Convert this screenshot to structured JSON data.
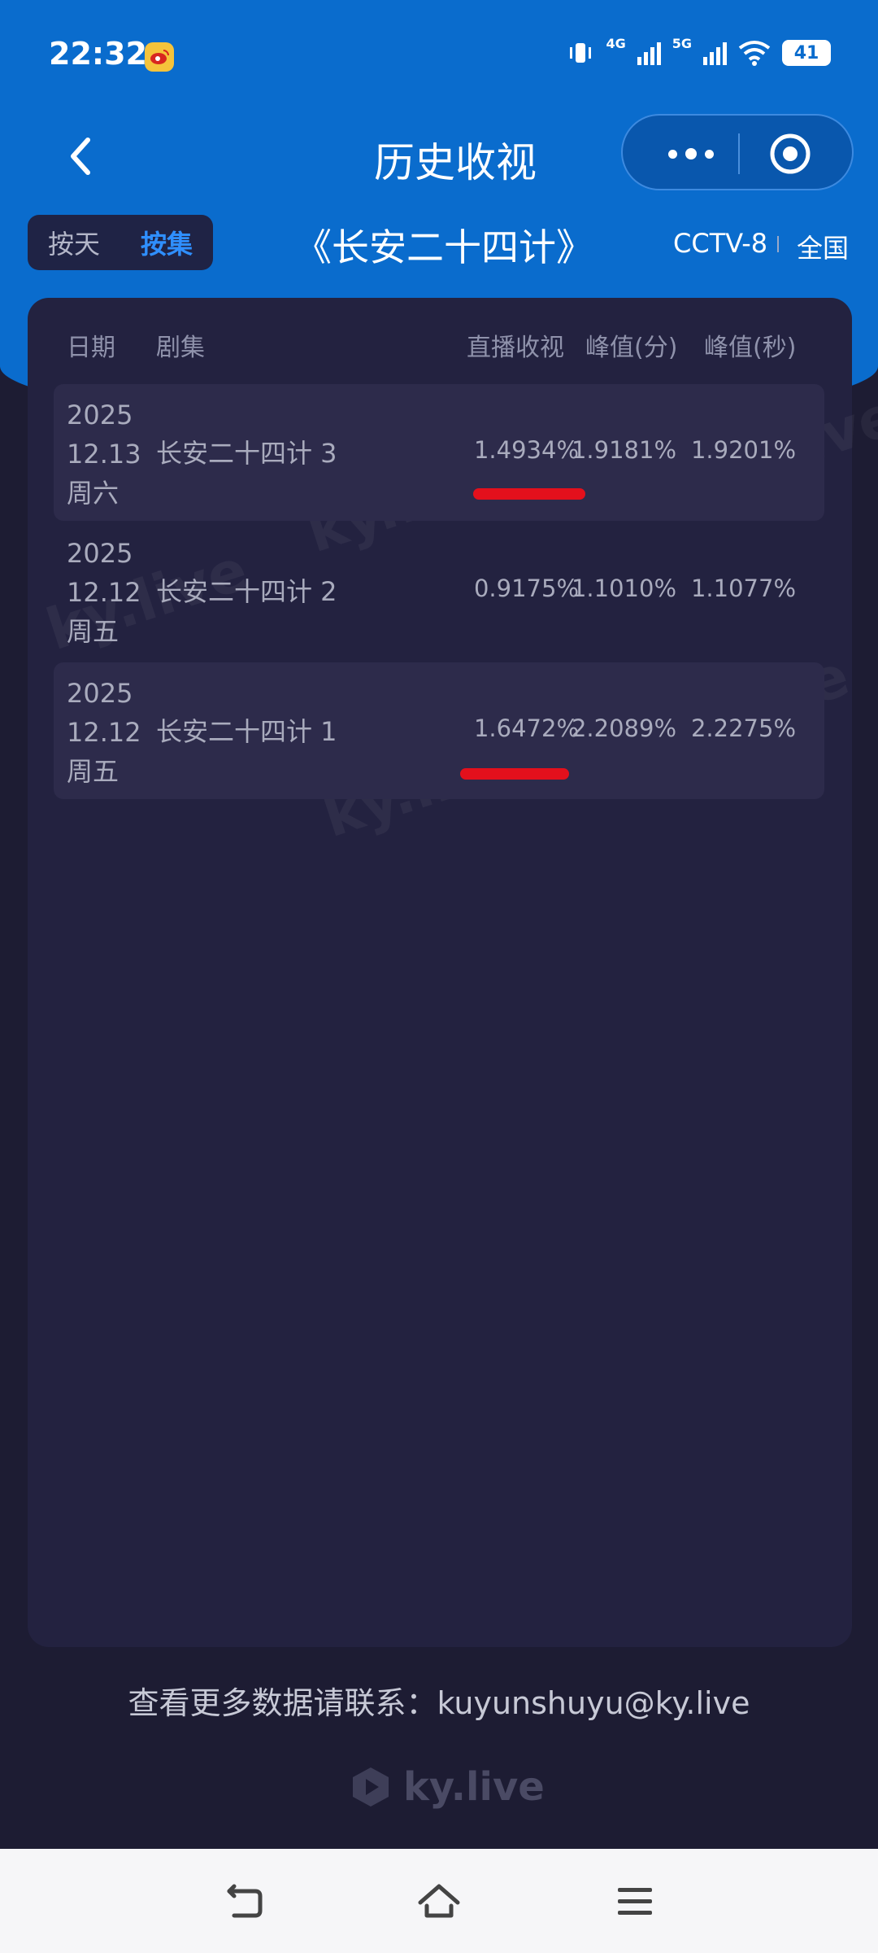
{
  "status_bar": {
    "time": "22:32",
    "network_1": "4G",
    "network_2": "5G",
    "battery": "41"
  },
  "nav": {
    "title": "历史收视"
  },
  "filter": {
    "tab_by_day": "按天",
    "tab_by_episode": "按集",
    "active_tab": "按集",
    "show_title": "《长安二十四计》",
    "channel": "CCTV-8",
    "region": "全国"
  },
  "table": {
    "headers": {
      "date": "日期",
      "episode": "剧集",
      "live_rating": "直播收视",
      "peak_minute": "峰值(分)",
      "peak_second": "峰值(秒)"
    },
    "rows": [
      {
        "year": "2025",
        "date": "12.13",
        "weekday": "周六",
        "episode": "长安二十四计 3",
        "live_rating": "1.4934%",
        "peak_minute": "1.9181%",
        "peak_second": "1.9201%"
      },
      {
        "year": "2025",
        "date": "12.12",
        "weekday": "周五",
        "episode": "长安二十四计 2",
        "live_rating": "0.9175%",
        "peak_minute": "1.1010%",
        "peak_second": "1.1077%"
      },
      {
        "year": "2025",
        "date": "12.12",
        "weekday": "周五",
        "episode": "长安二十四计 1",
        "live_rating": "1.6472%",
        "peak_minute": "2.2089%",
        "peak_second": "2.2275%"
      }
    ]
  },
  "watermark": "ky.live",
  "footer": {
    "contact": "查看更多数据请联系：kuyunshuyu@ky.live",
    "brand": "ky.live"
  },
  "colors": {
    "header_blue": "#0a6ccd",
    "active_tab": "#2f8fff",
    "background": "#1d1c33",
    "card": "#232240",
    "highlight_mark": "#e3101c"
  }
}
